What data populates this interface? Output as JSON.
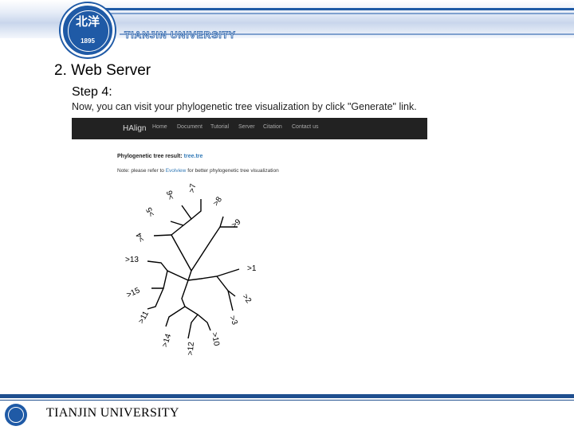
{
  "header": {
    "logo_cn": "北洋",
    "logo_year": "1895",
    "university": "TIANJIN UNIVERSITY"
  },
  "slide": {
    "section_title": "2. Web Server",
    "step_title": "Step 4:",
    "description": "Now, you can visit your phylogenetic tree visualization by click \"Generate\" link."
  },
  "screenshot": {
    "brand": "HAlign",
    "nav": [
      "Home",
      "Document",
      "Tutorial",
      "Server",
      "Citation",
      "Contact us"
    ],
    "result_label": "Phylogenetic tree result:",
    "result_link": "tree.tre",
    "note_prefix": "Note: please refer to",
    "note_link": "Evolview",
    "note_suffix": "for better phylogenetic tree visualization",
    "leaves": [
      ">1",
      ">2",
      ">3",
      ">4",
      ">5",
      ">6",
      ">7",
      ">8",
      ">9",
      ">10",
      ">11",
      ">12",
      ">13",
      ">14",
      ">15"
    ]
  },
  "footer": {
    "university": "TIANJIN UNIVERSITY"
  },
  "colors": {
    "brand_blue": "#1f5aa6",
    "navbar": "#222222",
    "link": "#337ab7"
  }
}
